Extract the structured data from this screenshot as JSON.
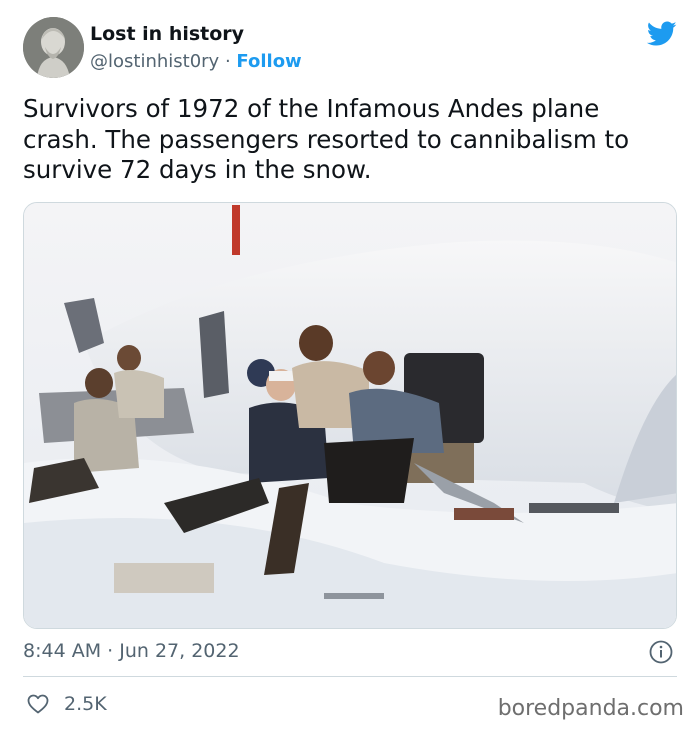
{
  "tweet": {
    "author_name": "Lost in history",
    "handle": "@lostinhist0ry",
    "separator": "·",
    "follow_label": "Follow",
    "text": "Survivors of 1972 of the Infamous Andes plane crash. The passengers resorted to cannibalism to survive 72 days in the snow.",
    "timestamp": "8:44 AM · Jun 27, 2022",
    "like_count": "2.5K"
  },
  "icons": {
    "brand": "twitter-bird-icon",
    "info": "info-icon",
    "like": "heart-icon"
  },
  "colors": {
    "accent": "#1d9bf0",
    "text": "#0f1419",
    "muted": "#536471"
  },
  "watermark": "boredpanda.com"
}
